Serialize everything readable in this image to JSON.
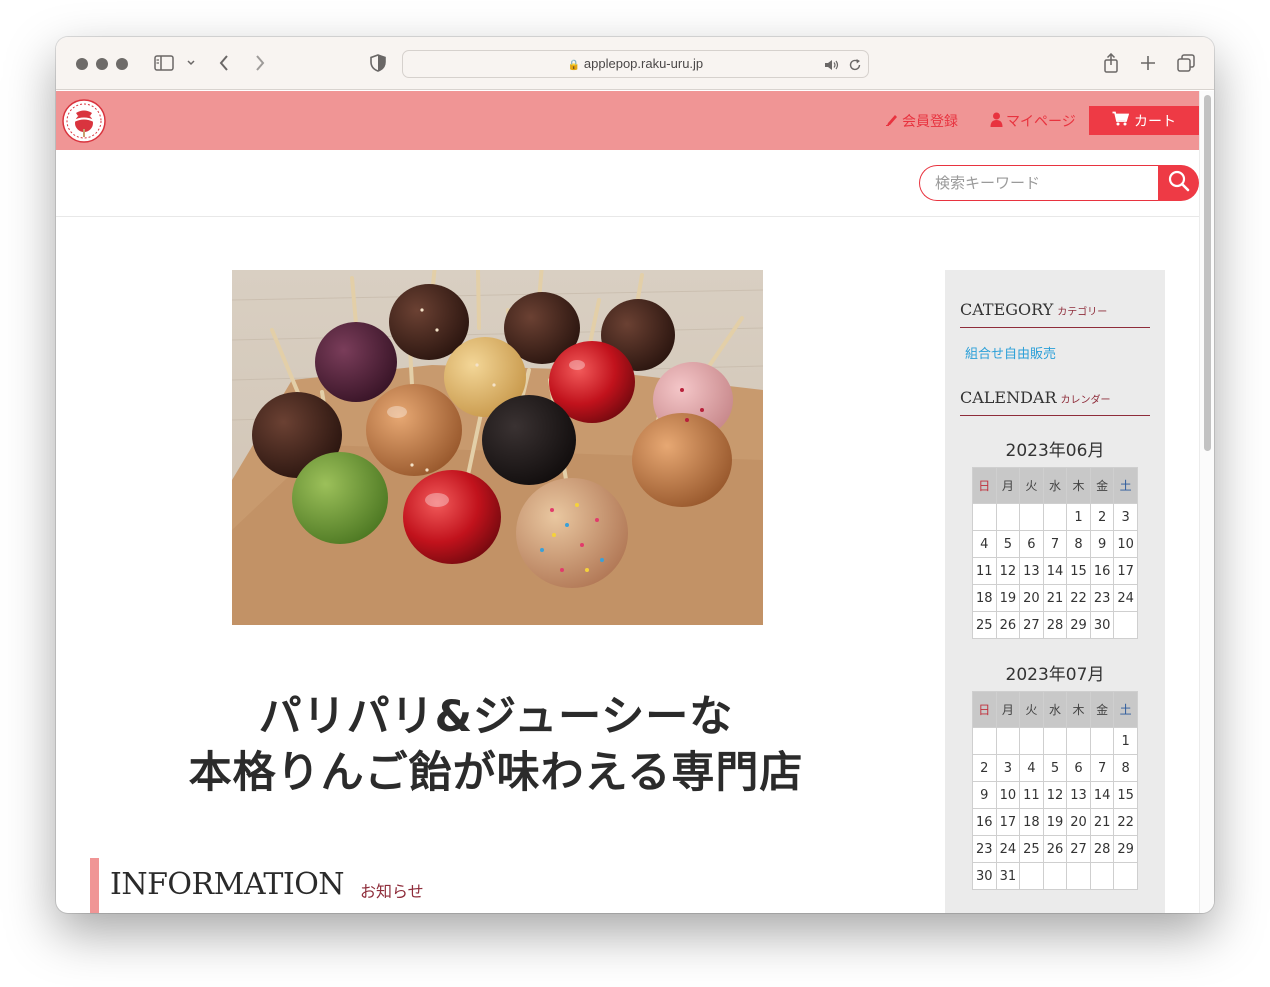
{
  "browser": {
    "url": "applepop.raku-uru.jp"
  },
  "site": {
    "logo_text": "Apple Pop",
    "header_links": {
      "register": "会員登録",
      "mypage": "マイページ",
      "cart": "カート"
    },
    "search": {
      "placeholder": "検索キーワード"
    },
    "catch_line1": "パリパリ&ジューシーな",
    "catch_line2": "本格りんご飴が味わえる専門店",
    "information": {
      "title": "INFORMATION",
      "subtitle": "お知らせ"
    },
    "colors": {
      "header_pink": "#f09595",
      "accent_red": "#ee3a45",
      "link_blue": "#2a9fd8",
      "maroon": "#8e2c3a"
    }
  },
  "sidebar": {
    "category": {
      "title": "CATEGORY",
      "subtitle": "カテゴリー",
      "items": [
        "組合せ自由販売"
      ]
    },
    "calendar": {
      "title": "CALENDAR",
      "subtitle": "カレンダー",
      "weekdays": [
        "日",
        "月",
        "火",
        "水",
        "木",
        "金",
        "土"
      ],
      "months": [
        {
          "caption": "2023年06月",
          "weeks": [
            [
              "",
              "",
              "",
              "",
              "1",
              "2",
              "3"
            ],
            [
              "4",
              "5",
              "6",
              "7",
              "8",
              "9",
              "10"
            ],
            [
              "11",
              "12",
              "13",
              "14",
              "15",
              "16",
              "17"
            ],
            [
              "18",
              "19",
              "20",
              "21",
              "22",
              "23",
              "24"
            ],
            [
              "25",
              "26",
              "27",
              "28",
              "29",
              "30",
              ""
            ]
          ]
        },
        {
          "caption": "2023年07月",
          "weeks": [
            [
              "",
              "",
              "",
              "",
              "",
              "",
              "1"
            ],
            [
              "2",
              "3",
              "4",
              "5",
              "6",
              "7",
              "8"
            ],
            [
              "9",
              "10",
              "11",
              "12",
              "13",
              "14",
              "15"
            ],
            [
              "16",
              "17",
              "18",
              "19",
              "20",
              "21",
              "22"
            ],
            [
              "23",
              "24",
              "25",
              "26",
              "27",
              "28",
              "29"
            ],
            [
              "30",
              "31",
              "",
              "",
              "",
              "",
              ""
            ]
          ]
        }
      ]
    }
  }
}
